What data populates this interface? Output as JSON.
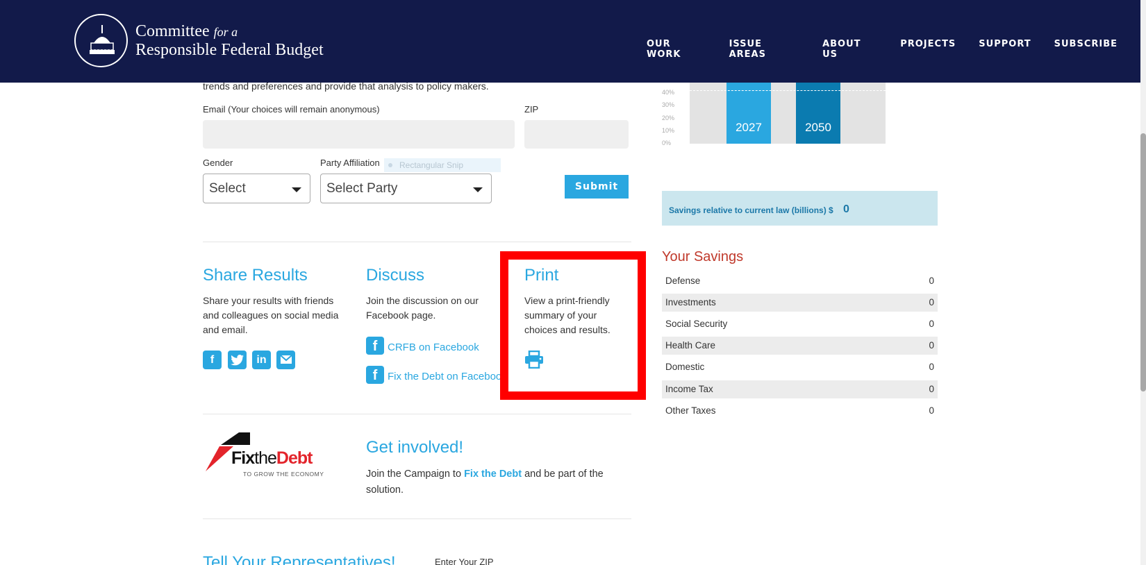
{
  "header": {
    "logo_line1": "Committee",
    "logo_line1_italic": "for a",
    "logo_line2": "Responsible Federal Budget",
    "nav": [
      "OUR WORK",
      "ISSUE AREAS",
      "ABOUT US",
      "PROJECTS",
      "SUPPORT",
      "SUBSCRIBE"
    ]
  },
  "form": {
    "intro": "trends and preferences and provide that analysis to policy makers.",
    "email_label": "Email (Your choices will remain anonymous)",
    "email_value": "",
    "zip_label": "ZIP",
    "zip_value": "",
    "gender_label": "Gender",
    "gender_value": "Select",
    "party_label": "Party Affiliation",
    "party_value": "Select Party",
    "snip_tooltip": "Rectangular Snip",
    "submit_label": "Submit"
  },
  "share": {
    "title": "Share Results",
    "text": "Share your results with friends and colleagues on social media and email.",
    "icons": [
      "facebook-icon",
      "twitter-icon",
      "linkedin-icon",
      "email-icon"
    ]
  },
  "discuss": {
    "title": "Discuss",
    "text": "Join the discussion on our Facebook page.",
    "link1": "CRFB on Facebook",
    "link2": "Fix the Debt on Facebook"
  },
  "print": {
    "title": "Print",
    "text": "View a print-friendly summary of your choices and results.",
    "icon": "printer-icon",
    "highlight_color": "#ff0000"
  },
  "get_involved": {
    "logo_fix": "Fix",
    "logo_the": "the",
    "logo_debt": "Debt",
    "logo_sub": "TO GROW THE ECONOMY",
    "title": "Get involved!",
    "text_before": "Join the Campaign to ",
    "link": "Fix the Debt",
    "text_after": " and be part of the solution."
  },
  "chart": {
    "y_ticks": [
      "40%",
      "30%",
      "20%",
      "10%",
      "0%"
    ],
    "bars": [
      {
        "label": "2027",
        "color": "#2aa7e0"
      },
      {
        "label": "2050",
        "color": "#0b7bb0"
      }
    ]
  },
  "savings": {
    "label": "Savings relative to current law (billions) $",
    "value": "0"
  },
  "your_savings": {
    "title": "Your Savings",
    "rows": [
      {
        "name": "Defense",
        "value": "0"
      },
      {
        "name": "Investments",
        "value": "0"
      },
      {
        "name": "Social Security",
        "value": "0"
      },
      {
        "name": "Health Care",
        "value": "0"
      },
      {
        "name": "Domestic",
        "value": "0"
      },
      {
        "name": "Income Tax",
        "value": "0"
      },
      {
        "name": "Other Taxes",
        "value": "0"
      }
    ]
  },
  "bottom": {
    "tell_title": "Tell Your Representatives!",
    "enter_zip": "Enter Your ZIP"
  }
}
